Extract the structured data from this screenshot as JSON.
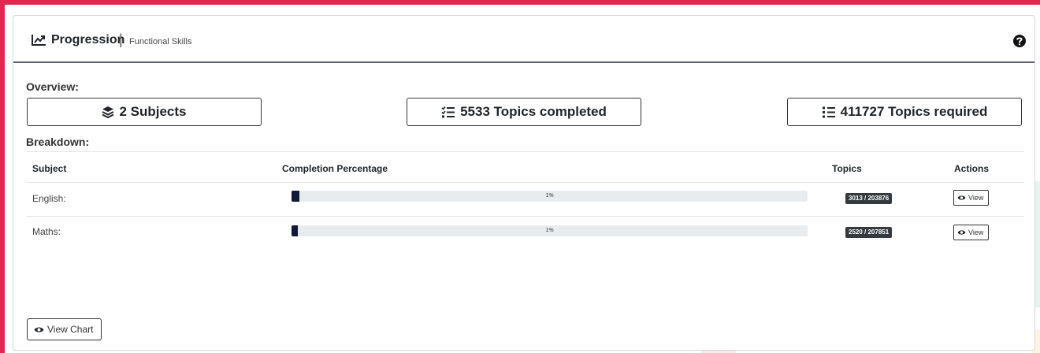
{
  "header": {
    "title": "Progression",
    "separator": "|",
    "subtitle": "Functional Skills",
    "icons": {
      "title": "chart-line-icon",
      "help": "question-circle-icon"
    }
  },
  "overview": {
    "label": "Overview:",
    "subjects": "2 Subjects",
    "topics_completed": "5533 Topics completed",
    "topics_required": "411727 Topics required"
  },
  "breakdown": {
    "label": "Breakdown:",
    "columns": [
      "Subject",
      "Completion Percentage",
      "Topics",
      "Actions"
    ],
    "rows": [
      {
        "subject": "English:",
        "percent_label": "1%",
        "percent_value": 1.48,
        "topics": "3013 / 203876",
        "action": "View"
      },
      {
        "subject": "Maths:",
        "percent_label": "1%",
        "percent_value": 1.21,
        "topics": "2520 / 207851",
        "action": "View"
      }
    ]
  },
  "footer": {
    "view_chart": "View Chart"
  },
  "colors": {
    "accent_border": "#e0284f",
    "progress_fill": "#121a3a",
    "badge_bg": "#343a40"
  }
}
